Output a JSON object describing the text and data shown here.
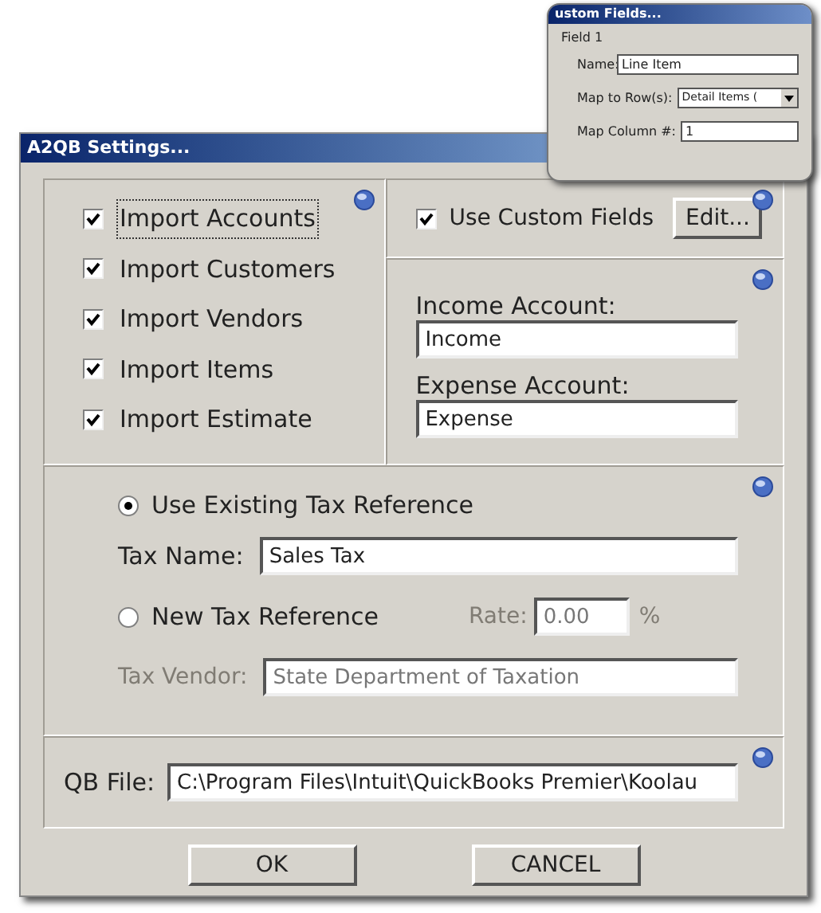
{
  "window": {
    "title": "A2QB Settings..."
  },
  "imports": [
    {
      "label": "Import Accounts",
      "checked": true,
      "focused": true
    },
    {
      "label": "Import Customers",
      "checked": true,
      "focused": false
    },
    {
      "label": "Import Vendors",
      "checked": true,
      "focused": false
    },
    {
      "label": "Import Items",
      "checked": true,
      "focused": false
    },
    {
      "label": "Import Estimate",
      "checked": true,
      "focused": false
    }
  ],
  "custom_fields": {
    "label": "Use Custom Fields",
    "checked": true,
    "edit_button": "Edit..."
  },
  "accounts": [
    {
      "label": "Income Account:",
      "value": "Income"
    },
    {
      "label": "Expense Account:",
      "value": "Expense"
    }
  ],
  "tax": {
    "options": [
      {
        "label": "Use Existing Tax Reference",
        "selected": true
      },
      {
        "label": "New Tax Reference",
        "selected": false
      }
    ],
    "tax_name": {
      "label": "Tax Name:",
      "value": "Sales Tax"
    },
    "rate": {
      "label": "Rate:",
      "value": "0.00",
      "unit": "%",
      "disabled": true
    },
    "tax_vendor": {
      "label": "Tax Vendor:",
      "value": "State Department of Taxation",
      "disabled": true
    }
  },
  "qb_file": {
    "label": "QB File:",
    "value": "C:\\Program Files\\Intuit\\QuickBooks Premier\\Koolau"
  },
  "buttons": [
    "OK",
    "CANCEL"
  ],
  "popup": {
    "title": "ustom Fields...",
    "group": "Field 1",
    "name": {
      "label": "Name:",
      "value": "Line Item"
    },
    "map_row": {
      "label": "Map to Row(s):",
      "value": "Detail Items ("
    },
    "map_column": {
      "label": "Map Column #:",
      "value": "1"
    }
  }
}
